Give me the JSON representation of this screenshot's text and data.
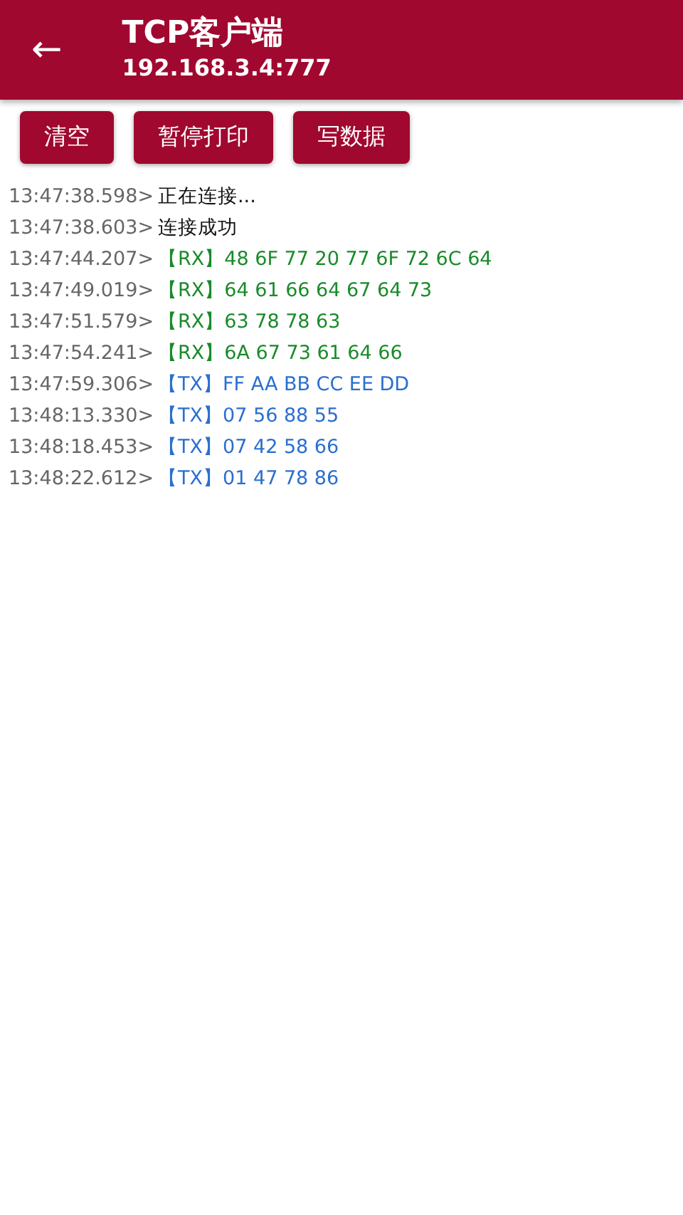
{
  "header": {
    "back": "←",
    "title": "TCP客户端",
    "subtitle": "192.168.3.4:777"
  },
  "buttons": [
    "清空",
    "暂停打印",
    "写数据"
  ],
  "log": [
    {
      "time": "13:47:38.598>",
      "kind": "status",
      "text": "正在连接..."
    },
    {
      "time": "13:47:38.603>",
      "kind": "status",
      "text": "连接成功"
    },
    {
      "time": "13:47:44.207>",
      "kind": "rx",
      "text": "【RX】48 6F 77 20 77 6F 72 6C 64"
    },
    {
      "time": "13:47:49.019>",
      "kind": "rx",
      "text": "【RX】64 61 66 64 67 64 73"
    },
    {
      "time": "13:47:51.579>",
      "kind": "rx",
      "text": "【RX】63 78 78 63"
    },
    {
      "time": "13:47:54.241>",
      "kind": "rx",
      "text": "【RX】6A 67 73 61 64 66"
    },
    {
      "time": "13:47:59.306>",
      "kind": "tx",
      "text": "【TX】FF AA BB CC EE DD"
    },
    {
      "time": "13:48:13.330>",
      "kind": "tx",
      "text": "【TX】07 56 88 55"
    },
    {
      "time": "13:48:18.453>",
      "kind": "tx",
      "text": "【TX】07 42 58 66"
    },
    {
      "time": "13:48:22.612>",
      "kind": "tx",
      "text": "【TX】01 47 78 86"
    }
  ]
}
